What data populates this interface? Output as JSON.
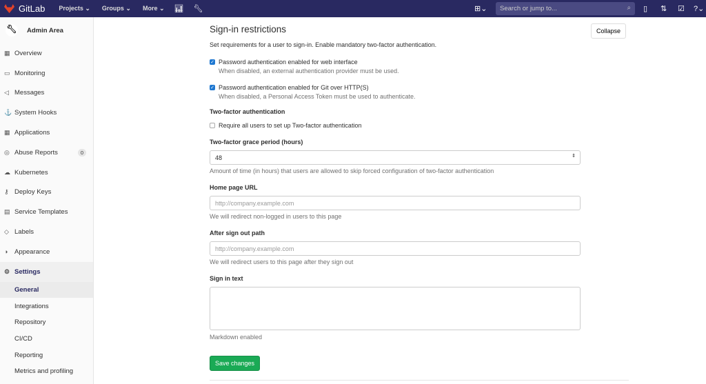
{
  "nav": {
    "brand": "GitLab",
    "projects": "Projects",
    "groups": "Groups",
    "more": "More",
    "search_placeholder": "Search or jump to..."
  },
  "sidebar": {
    "title": "Admin Area",
    "items": [
      {
        "label": "Overview",
        "icon": "▦"
      },
      {
        "label": "Monitoring",
        "icon": "▭"
      },
      {
        "label": "Messages",
        "icon": "◁"
      },
      {
        "label": "System Hooks",
        "icon": "⚓"
      },
      {
        "label": "Applications",
        "icon": "▦"
      },
      {
        "label": "Abuse Reports",
        "icon": "◎",
        "badge": "0"
      },
      {
        "label": "Kubernetes",
        "icon": "☁"
      },
      {
        "label": "Deploy Keys",
        "icon": "⚷"
      },
      {
        "label": "Service Templates",
        "icon": "▤"
      },
      {
        "label": "Labels",
        "icon": "◇"
      },
      {
        "label": "Appearance",
        "icon": "◑"
      },
      {
        "label": "Settings",
        "icon": "⚙"
      }
    ],
    "sub": [
      "General",
      "Integrations",
      "Repository",
      "CI/CD",
      "Reporting",
      "Metrics and profiling"
    ]
  },
  "main": {
    "title": "Sign-in restrictions",
    "collapse": "Collapse",
    "description": "Set requirements for a user to sign-in. Enable mandatory two-factor authentication.",
    "pw_web": {
      "label": "Password authentication enabled for web interface",
      "help": "When disabled, an external authentication provider must be used.",
      "checked": true
    },
    "pw_git": {
      "label": "Password authentication enabled for Git over HTTP(S)",
      "help": "When disabled, a Personal Access Token must be used to authenticate.",
      "checked": true
    },
    "tfa_heading": "Two-factor authentication",
    "tfa_require": "Require all users to set up Two-factor authentication",
    "grace_label": "Two-factor grace period (hours)",
    "grace_value": "48",
    "grace_help": "Amount of time (in hours) that users are allowed to skip forced configuration of two-factor authentication",
    "home_label": "Home page URL",
    "home_placeholder": "http://company.example.com",
    "home_help": "We will redirect non-logged in users to this page",
    "signout_label": "After sign out path",
    "signout_placeholder": "http://company.example.com",
    "signout_help": "We will redirect users to this page after they sign out",
    "signin_text_label": "Sign in text",
    "signin_text_help": "Markdown enabled",
    "save": "Save changes"
  }
}
